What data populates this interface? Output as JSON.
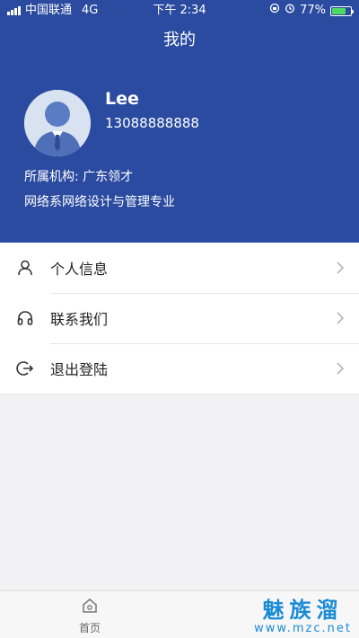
{
  "status": {
    "carrier": "中国联通",
    "network": "4G",
    "time": "下午 2:34",
    "battery": "77%",
    "battery_level": 0.77
  },
  "header": {
    "title": "我的"
  },
  "profile": {
    "name": "Lee",
    "phone": "13088888888",
    "organization": "所属机构: 广东领才",
    "major": "网络系网络设计与管理专业"
  },
  "menu": [
    {
      "label": "个人信息",
      "icon": "person-icon"
    },
    {
      "label": "联系我们",
      "icon": "headphones-icon"
    },
    {
      "label": "退出登陆",
      "icon": "logout-icon"
    }
  ],
  "tabbar": {
    "home_label": "首页",
    "home_icon": "home-icon"
  },
  "watermark": {
    "title": "魅族溜",
    "url": "www.mzc.net"
  },
  "colors": {
    "header_bg": "#2b4ba0",
    "background": "#f2f2f4",
    "battery": "#4cd964",
    "watermark": "#1a8bd6"
  }
}
